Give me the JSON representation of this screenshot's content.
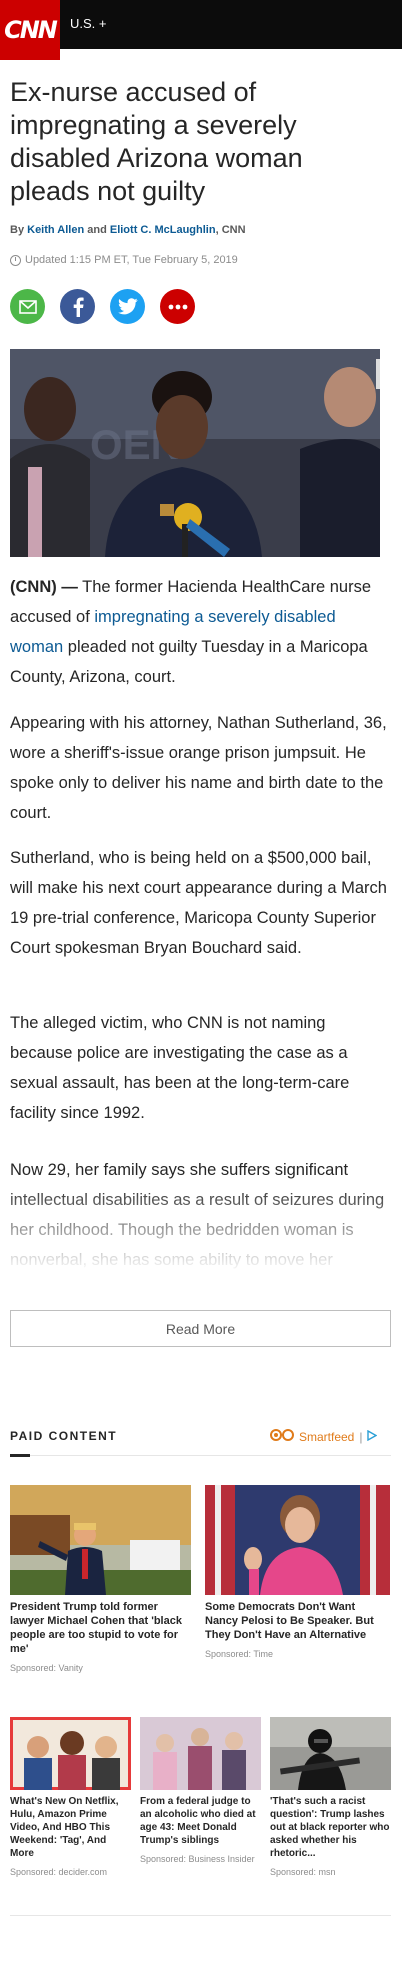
{
  "header": {
    "logo": "CNN",
    "section": "U.S. +"
  },
  "article": {
    "headline": "Ex-nurse accused of impregnating a severely disabled Arizona woman pleads not guilty",
    "byline_prefix": "By",
    "author1": "Keith Allen",
    "byline_and": "and",
    "author2": "Eliott C. McLaughlin",
    "byline_suffix": ", CNN",
    "updated": "Updated 1:15 PM ET, Tue February 5, 2019",
    "p1_lead": "(CNN) —",
    "p1_a": " The former Hacienda HealthCare nurse accused of ",
    "p1_link": "impregnating a severely disabled woman",
    "p1_b": " pleaded not guilty Tuesday in a Maricopa County, Arizona, court.",
    "p2": "Appearing with his attorney, Nathan Sutherland, 36, wore a sheriff's-issue orange prison jumpsuit. He spoke only to deliver his name and birth date to the court.",
    "p3": "Sutherland, who is being held on a $500,000 bail, will make his next court appearance during a March 19 pre-trial conference, Maricopa County Superior Court spokesman Bryan Bouchard said.",
    "p4": "The alleged victim, who CNN is not naming because police are investigating the case as a sexual assault, has been at the long-term-care facility since 1992.",
    "p5": "Now 29, her family says she suffers significant intellectual disabilities as a result of seizures during her childhood. Though the bedridden woman is nonverbal, she has some ability to move her extremities, responds to sound and",
    "read_more": "Read More"
  },
  "share": {
    "email": "email-icon",
    "facebook": "facebook-icon",
    "twitter": "twitter-icon",
    "more": "more-icon"
  },
  "paid": {
    "label": "PAID CONTENT",
    "smartfeed": "Smartfeed",
    "smartfeed_sep": "|",
    "cards": [
      {
        "title": "President Trump told former lawyer Michael Cohen that 'black people are too stupid to vote for me'",
        "source": "Sponsored: Vanity"
      },
      {
        "title": "Some Democrats Don't Want Nancy Pelosi to Be Speaker. But They Don't Have an Alternative",
        "source": "Sponsored: Time"
      },
      {
        "title": "What's New On Netflix, Hulu, Amazon Prime Video, And HBO This Weekend: 'Tag', And More",
        "source": "Sponsored: decider.com"
      },
      {
        "title": "From a federal judge to an alcoholic who died at age 43: Meet Donald Trump's siblings",
        "source": "Sponsored: Business Insider"
      },
      {
        "title": "'That's such a racist question': Trump lashes out at black reporter who asked whether his rhetoric...",
        "source": "Sponsored: msn"
      }
    ]
  },
  "colors": {
    "brand": "#cc0000",
    "link": "#0c5a93",
    "email": "#4cb748",
    "facebook": "#3b5998",
    "twitter": "#1da1f2",
    "more": "#cc0000"
  }
}
